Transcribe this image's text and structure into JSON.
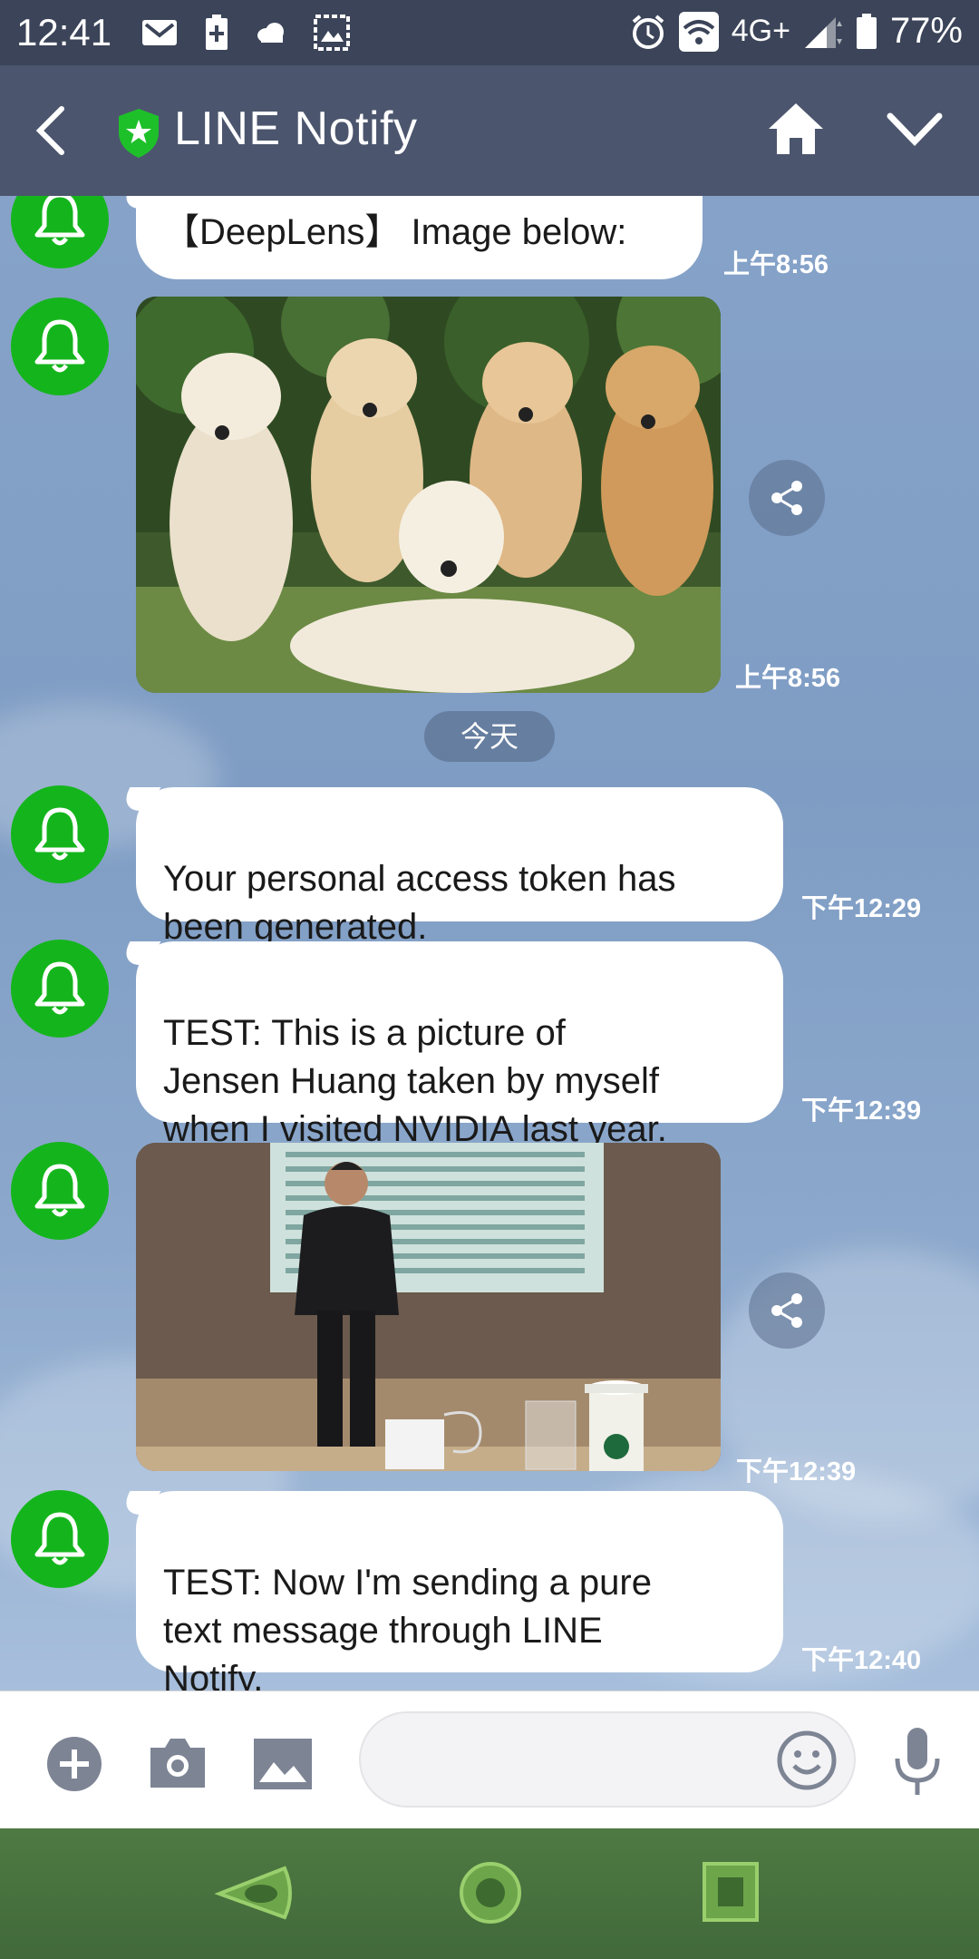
{
  "status_bar": {
    "time": "12:41",
    "network": "4G+",
    "battery": "77%",
    "icons_left": [
      "gmail-icon",
      "battery-saver-icon",
      "cloud-icon",
      "image-icon"
    ],
    "icons_right": [
      "alarm-icon",
      "wifi-icon",
      "signal-icon",
      "battery-icon"
    ]
  },
  "header": {
    "title": "LINE Notify",
    "back_icon": "chevron-left-icon",
    "badge_icon": "shield-star-icon",
    "home_icon": "home-icon",
    "menu_icon": "chevron-down-icon"
  },
  "chat": {
    "date_divider": "今天",
    "messages": [
      {
        "type": "text",
        "text": "【DeepLens】 Image below:",
        "time": "上午8:56"
      },
      {
        "type": "image",
        "description_icon": "photo",
        "time": "上午8:56"
      },
      {
        "type": "text",
        "text": "Your personal access token has\nbeen generated.",
        "time": "下午12:29"
      },
      {
        "type": "text",
        "text": "TEST: This is a picture of\nJensen Huang taken by myself\nwhen I visited NVIDIA last year.",
        "time": "下午12:39"
      },
      {
        "type": "image",
        "description_icon": "photo",
        "time": "下午12:39"
      },
      {
        "type": "text",
        "text": "TEST: Now I'm sending a pure\ntext message through LINE\nNotify.",
        "time": "下午12:40"
      }
    ]
  },
  "input_bar": {
    "buttons": [
      "plus-icon",
      "camera-icon",
      "gallery-icon"
    ],
    "emoji_icon": "smiley-icon",
    "mic_icon": "microphone-icon",
    "value": ""
  },
  "nav_bar": {
    "buttons": [
      "back-icon",
      "home-icon",
      "recents-icon"
    ]
  },
  "colors": {
    "header": "#4b556d",
    "status_bar": "#3b4458",
    "avatar": "#14b51c",
    "chat_bg": "#7f9fc4"
  }
}
